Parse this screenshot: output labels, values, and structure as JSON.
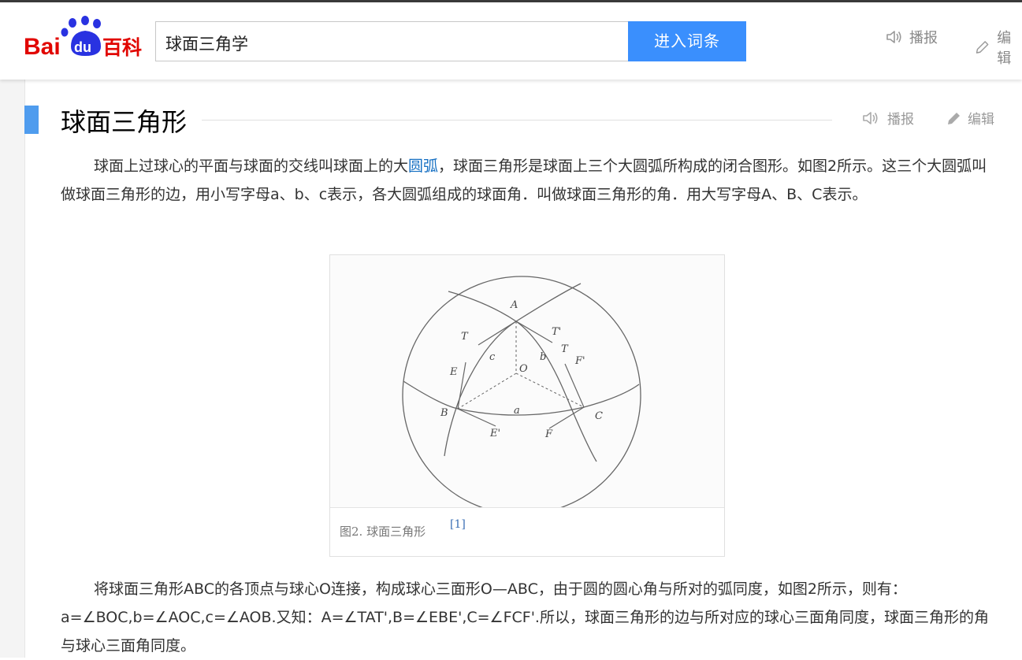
{
  "header": {
    "logo_text_bai": "Bai",
    "logo_text_du": "du",
    "logo_text_baike": "百科",
    "search_value": "球面三角学",
    "search_button": "进入词条",
    "broadcast_label": "播报",
    "edit_label": "编辑"
  },
  "section": {
    "title": "球面三角形",
    "broadcast_label": "播报",
    "edit_label": "编辑"
  },
  "para1": {
    "before_link": "球面上过球心的平面与球面的交线叫球面上的大",
    "link": "圆弧",
    "after_link": "，球面三角形是球面上三个大圆弧所构成的闭合图形。如图2所示。这三个大圆弧叫做球面三角形的边，用小写字母a、b、c表示，各大圆弧组成的球面角．叫做球面三角形的角．用大写字母A、B、C表示。"
  },
  "figure": {
    "caption": "图2. 球面三角形",
    "ref": "[1]",
    "labels": {
      "A": "A",
      "T1": "T",
      "T2": "T'",
      "T3": "T",
      "F1": "F'",
      "c": "c",
      "O": "O",
      "b": "b",
      "E": "E",
      "B": "B",
      "a": "a",
      "C": "C",
      "E2": "E'",
      "F": "F"
    }
  },
  "para2": {
    "text": "将球面三角形ABC的各顶点与球心O连接，构成球心三面形O—ABC，由于圆的圆心角与所对的弧同度，如图2所示，则有：a=∠BOC,b=∠AOC,c=∠AOB.又知：A=∠TAT',B=∠EBE',C=∠FCF'.所以，球面三角形的边与所对应的球心三面角同度，球面三角形的角与球心三面角同度。"
  },
  "colors": {
    "logo_red": "#e10601",
    "logo_blue": "#2932e1",
    "search_button": "#3a8ffd",
    "title_marker": "#4f9cee",
    "link": "#136ec2"
  }
}
